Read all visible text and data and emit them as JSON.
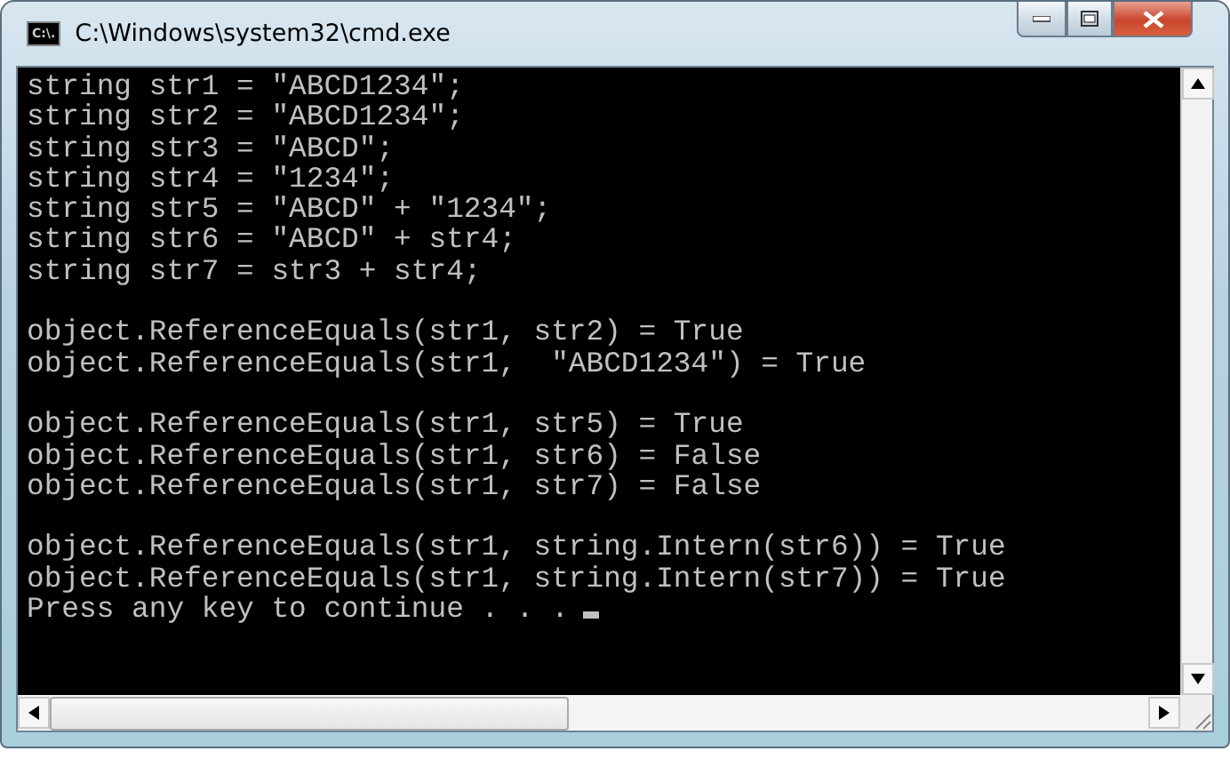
{
  "window": {
    "title": "C:\\Windows\\system32\\cmd.exe",
    "icon_text": "C:\\."
  },
  "console": {
    "blocks": [
      [
        "string str1 = \"ABCD1234\";",
        "string str2 = \"ABCD1234\";",
        "string str3 = \"ABCD\";",
        "string str4 = \"1234\";",
        "string str5 = \"ABCD\" + \"1234\";",
        "string str6 = \"ABCD\" + str4;",
        "string str7 = str3 + str4;"
      ],
      [
        "object.ReferenceEquals(str1, str2) = True",
        "object.ReferenceEquals(str1,  \"ABCD1234\") = True"
      ],
      [
        "object.ReferenceEquals(str1, str5) = True",
        "object.ReferenceEquals(str1, str6) = False",
        "object.ReferenceEquals(str1, str7) = False"
      ],
      [
        "object.ReferenceEquals(str1, string.Intern(str6)) = True",
        "object.ReferenceEquals(str1, string.Intern(str7)) = True",
        "Press any key to continue . . ."
      ]
    ],
    "cursor": true
  }
}
